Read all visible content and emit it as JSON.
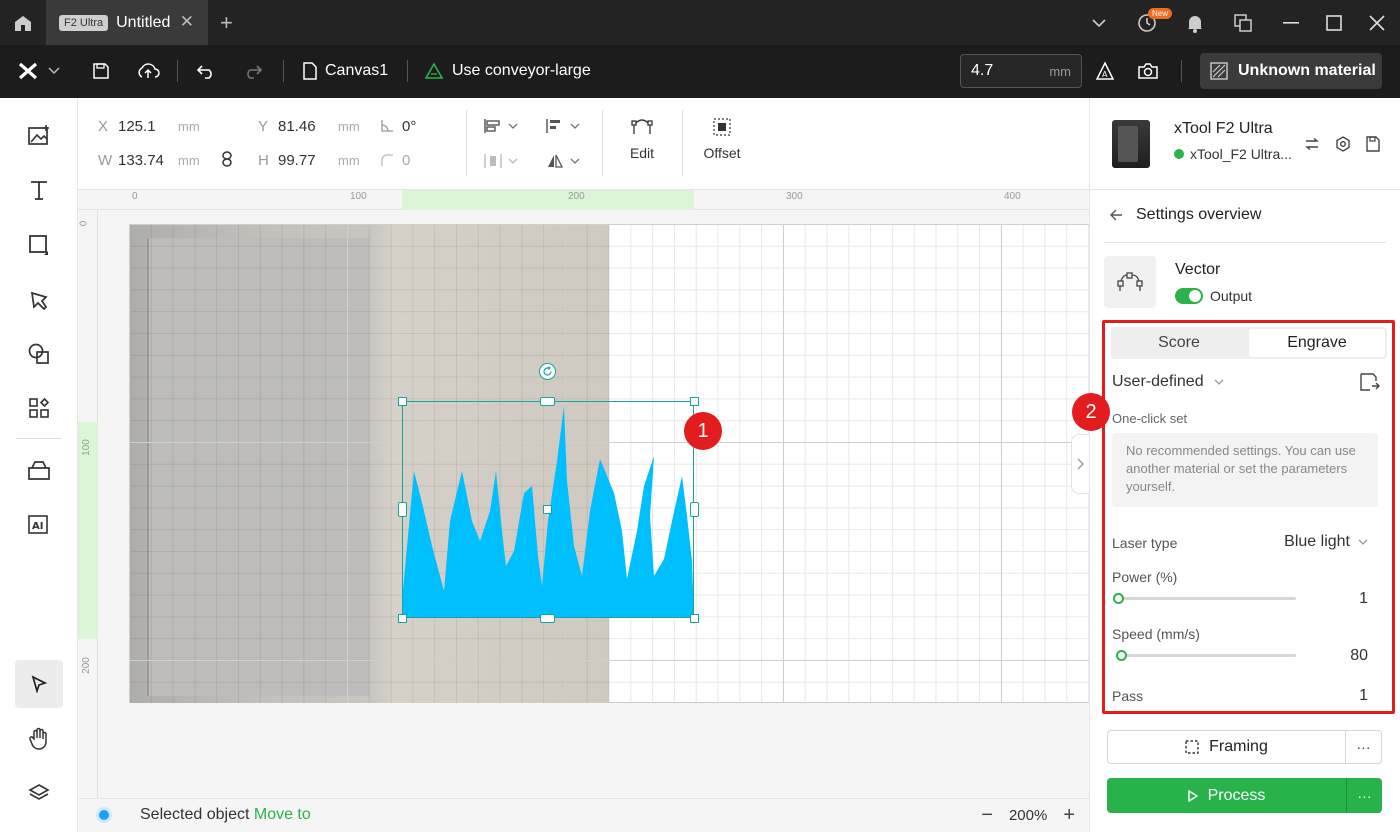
{
  "titlebar": {
    "model_badge": "F2 Ultra",
    "tab_title": "Untitled",
    "new_badge": "New"
  },
  "toolbar": {
    "canvas_name": "Canvas1",
    "conveyor_label": "Use conveyor-large",
    "thickness_value": "4.7",
    "thickness_unit": "mm",
    "material_label": "Unknown material"
  },
  "properties": {
    "x_label": "X",
    "x_value": "125.1",
    "x_unit": "mm",
    "y_label": "Y",
    "y_value": "81.46",
    "y_unit": "mm",
    "w_label": "W",
    "w_value": "133.74",
    "w_unit": "mm",
    "h_label": "H",
    "h_value": "99.77",
    "h_unit": "mm",
    "rotation": "0°",
    "corner_radius": "0",
    "edit_label": "Edit",
    "offset_label": "Offset"
  },
  "rulers": {
    "h_ticks": [
      "0",
      "100",
      "200",
      "300",
      "400"
    ],
    "v_ticks": [
      "0",
      "100",
      "200"
    ]
  },
  "canvas": {
    "callout_1": "1",
    "shape_color": "#00bfff"
  },
  "statusbar": {
    "selected_text": "Selected object",
    "move_to_link": "Move to",
    "zoom_level": "200%"
  },
  "device": {
    "name": "xTool F2 Ultra",
    "connection": "xTool_F2 Ultra..."
  },
  "settings": {
    "title": "Settings overview",
    "layer_name": "Vector",
    "output_label": "Output",
    "tabs": [
      "Score",
      "Engrave"
    ],
    "active_tab": "Engrave",
    "preset": "User-defined",
    "one_click_label": "One-click set",
    "no_recommend_text": "No recommended settings. You can use another material or set the parameters yourself.",
    "laser_type_label": "Laser type",
    "laser_type_value": "Blue light",
    "power_label": "Power (%)",
    "power_value": "1",
    "power_fraction": 0.01,
    "speed_label": "Speed (mm/s)",
    "speed_value": "80",
    "speed_fraction": 0.03,
    "pass_label": "Pass",
    "pass_value": "1",
    "callout_2": "2"
  },
  "actions": {
    "framing_label": "Framing",
    "process_label": "Process",
    "more_label": "···"
  },
  "colors": {
    "accent_green": "#27b34a",
    "callout_red": "#e31d1d",
    "selection_teal": "#1aa39a"
  }
}
